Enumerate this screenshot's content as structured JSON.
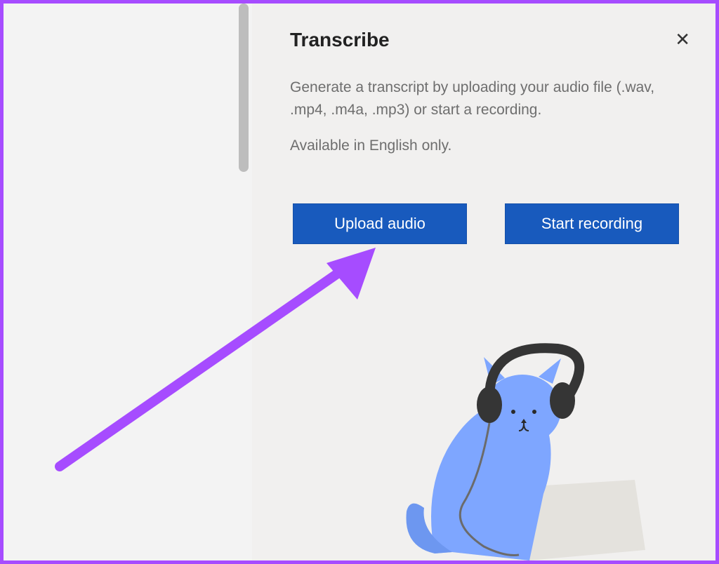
{
  "panel": {
    "title": "Transcribe",
    "description": "Generate a transcript by uploading your audio file (.wav, .mp4, .m4a, .mp3) or start a recording.",
    "note": "Available in English only.",
    "close_label": "✕"
  },
  "buttons": {
    "upload_label": "Upload audio",
    "record_label": "Start recording"
  },
  "colors": {
    "accent": "#a64cff",
    "primary_button": "#185abd"
  }
}
